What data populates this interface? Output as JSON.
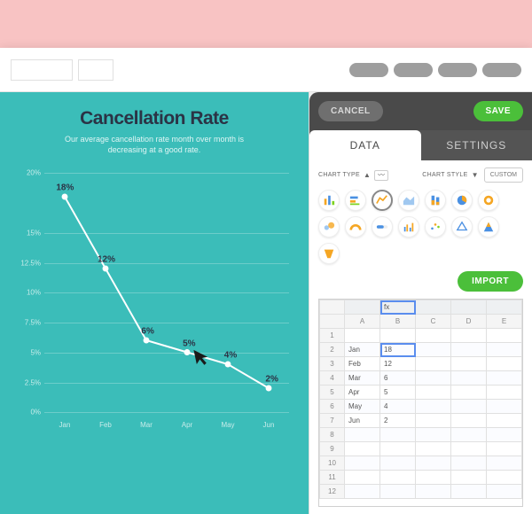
{
  "chart_data": {
    "type": "line",
    "title": "Cancellation Rate",
    "subtitle": "Our average cancellation rate month over month is decreasing at a good rate.",
    "xlabel": "",
    "ylabel": "",
    "categories": [
      "Jan",
      "Feb",
      "Mar",
      "Apr",
      "May",
      "Jun"
    ],
    "values": [
      18,
      12,
      6,
      5,
      4,
      2
    ],
    "value_suffix": "%",
    "y_ticks": [
      0,
      2.5,
      5,
      7.5,
      10,
      12.5,
      15,
      20
    ],
    "y_tick_labels": [
      "0%",
      "2.5%",
      "5%",
      "7.5%",
      "10%",
      "12.5%",
      "15%",
      "20%"
    ],
    "ylim": [
      0,
      20
    ],
    "grid": true,
    "colors": {
      "line": "#ffffff",
      "point": "#ffffff",
      "label": "#2b3345"
    }
  },
  "toolbar": {
    "cancel_label": "CANCEL",
    "save_label": "SAVE"
  },
  "tabs": {
    "data_label": "DATA",
    "settings_label": "SETTINGS",
    "active": "data"
  },
  "selects": {
    "chart_type_label": "CHART TYPE",
    "chart_style_label": "CHART STYLE",
    "custom_label": "CUSTOM"
  },
  "import_label": "IMPORT",
  "chart_type_options": [
    "vertical-bar",
    "horizontal-bar",
    "line",
    "area",
    "stacked-bar",
    "pie",
    "donut",
    "bubble",
    "gauge",
    "progress",
    "multi-bar",
    "scatter",
    "radar",
    "pyramid",
    "funnel"
  ],
  "chart_type_selected": "line",
  "sheet": {
    "columns": [
      "A",
      "B",
      "C",
      "D",
      "E"
    ],
    "fx_indicator": "fx",
    "rows": [
      {
        "n": 1,
        "cells": [
          "",
          "",
          "",
          "",
          ""
        ]
      },
      {
        "n": 2,
        "cells": [
          "Jan",
          "18",
          "",
          "",
          ""
        ]
      },
      {
        "n": 3,
        "cells": [
          "Feb",
          "12",
          "",
          "",
          ""
        ]
      },
      {
        "n": 4,
        "cells": [
          "Mar",
          "6",
          "",
          "",
          ""
        ]
      },
      {
        "n": 5,
        "cells": [
          "Apr",
          "5",
          "",
          "",
          ""
        ]
      },
      {
        "n": 6,
        "cells": [
          "May",
          "4",
          "",
          "",
          ""
        ]
      },
      {
        "n": 7,
        "cells": [
          "Jun",
          "2",
          "",
          "",
          ""
        ]
      },
      {
        "n": 8,
        "cells": [
          "",
          "",
          "",
          "",
          ""
        ]
      },
      {
        "n": 9,
        "cells": [
          "",
          "",
          "",
          "",
          ""
        ]
      },
      {
        "n": 10,
        "cells": [
          "",
          "",
          "",
          "",
          ""
        ]
      },
      {
        "n": 11,
        "cells": [
          "",
          "",
          "",
          "",
          ""
        ]
      },
      {
        "n": 12,
        "cells": [
          "",
          "",
          "",
          "",
          ""
        ]
      }
    ],
    "selected": {
      "row": 2,
      "col": 1
    }
  }
}
